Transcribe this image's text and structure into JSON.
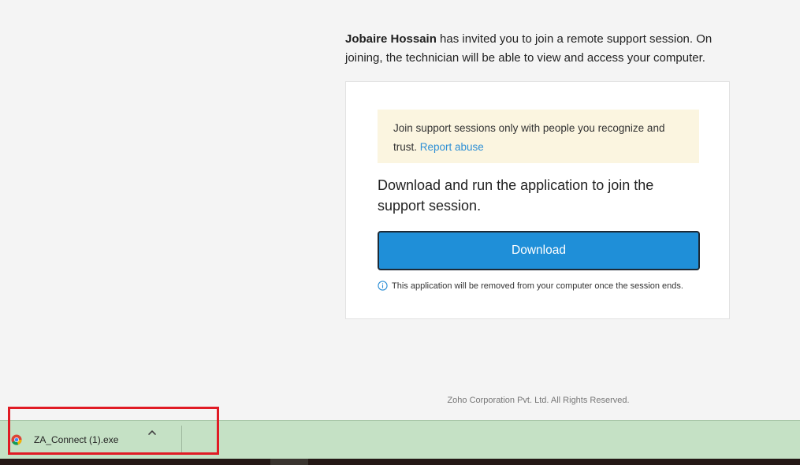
{
  "invite": {
    "inviter_name": "Jobaire Hossain",
    "message": " has invited you to join a remote support session. On joining, the technician will be able to view and access your computer."
  },
  "card": {
    "warning_text": "Join support sessions only with people you recognize and trust. ",
    "report_link": "Report abuse",
    "instruction": "Download and run the application to join the support session.",
    "download_label": "Download",
    "note": "This application will be removed from your computer once the session ends."
  },
  "footer": {
    "copyright": "Zoho Corporation Pvt. Ltd. All Rights Reserved."
  },
  "download_bar": {
    "file_name": "ZA_Connect (1).exe",
    "file_icon": "chrome-file-icon",
    "menu_icon": "chevron-up-icon"
  },
  "colors": {
    "accent": "#1f8fd8",
    "link": "#2d8fd5",
    "warning_bg": "#fbf5e0",
    "download_bar_bg": "#c5e1c5",
    "highlight": "#e01b24"
  }
}
